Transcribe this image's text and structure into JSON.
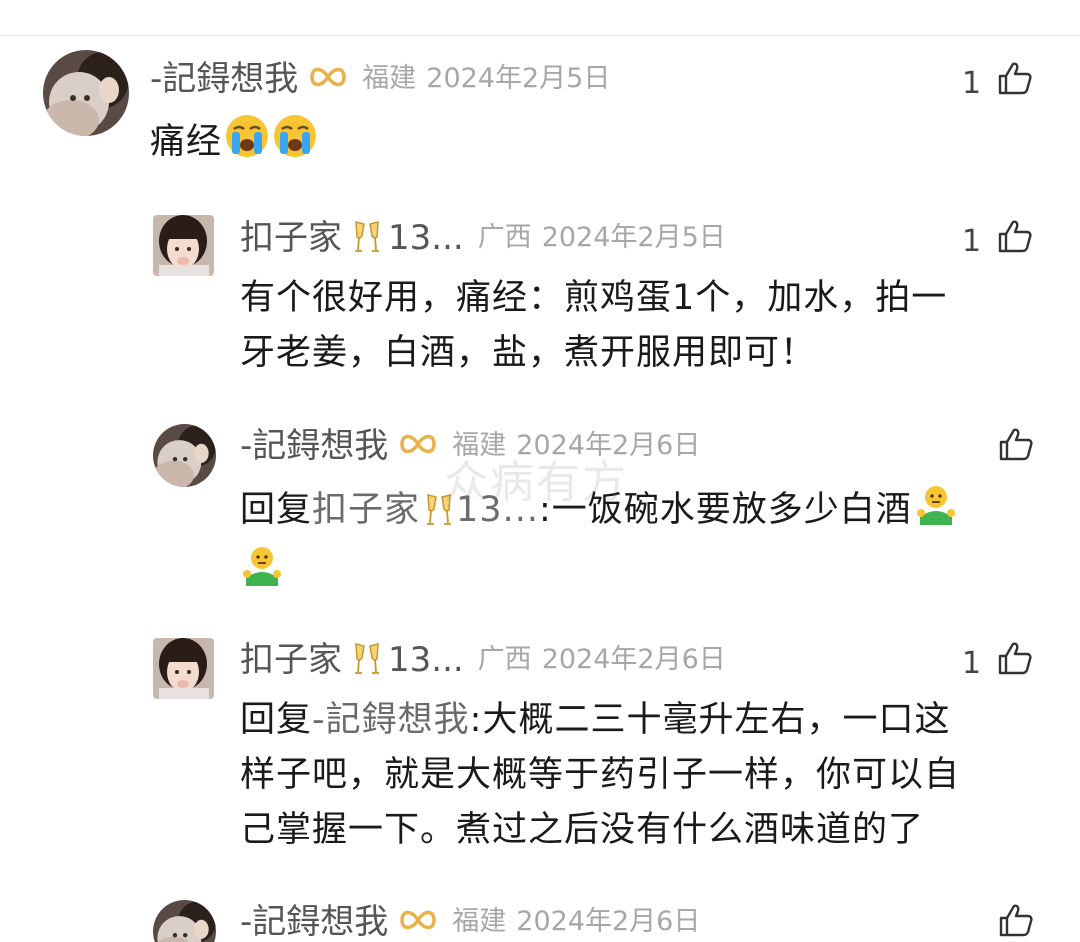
{
  "comments": [
    {
      "username": "-記鍀想我",
      "region": "福建",
      "date": "2024年2月5日",
      "likes": "1",
      "text": "痛经"
    },
    {
      "username": "扣子家",
      "username_suffix": "13...",
      "region": "广西",
      "date": "2024年2月5日",
      "likes": "1",
      "text_line1": "有个很好用，痛经：煎鸡蛋1个，加水，拍一",
      "text_line2": "牙老姜，白酒，盐，煮开服用即可！"
    },
    {
      "username": "-記鍀想我",
      "region": "福建",
      "date": "2024年2月6日",
      "likes": "",
      "reply_prefix": "回复",
      "reply_target": "扣子家",
      "reply_target_suffix": "13...",
      "text": ":一饭碗水要放多少白酒"
    },
    {
      "username": "扣子家",
      "username_suffix": "13...",
      "region": "广西",
      "date": "2024年2月6日",
      "likes": "1",
      "reply_prefix": "回复",
      "reply_target": "-記鍀想我",
      "text_line1": ":大概二三十毫升左右，一口这",
      "text_line2": "样子吧，就是大概等于药引子一样，你可以自",
      "text_line3": "己掌握一下。煮过之后没有什么酒味道的了"
    },
    {
      "username": "-記鍀想我",
      "region": "福建",
      "date": "2024年2月6日",
      "likes": ""
    }
  ],
  "watermark": "众病有方",
  "icons": {
    "like": "thumbs-up-icon",
    "badge_infinity": "infinity-badge-icon",
    "badge_cheers": "champagne-glasses-icon",
    "emoji_crying": "loudly-crying-face-icon",
    "emoji_shrug": "person-shrugging-icon"
  },
  "colors": {
    "username": "#555555",
    "meta": "#a7a7a7",
    "text": "#1a1a1a",
    "badge_gold": "#e8b14a"
  }
}
